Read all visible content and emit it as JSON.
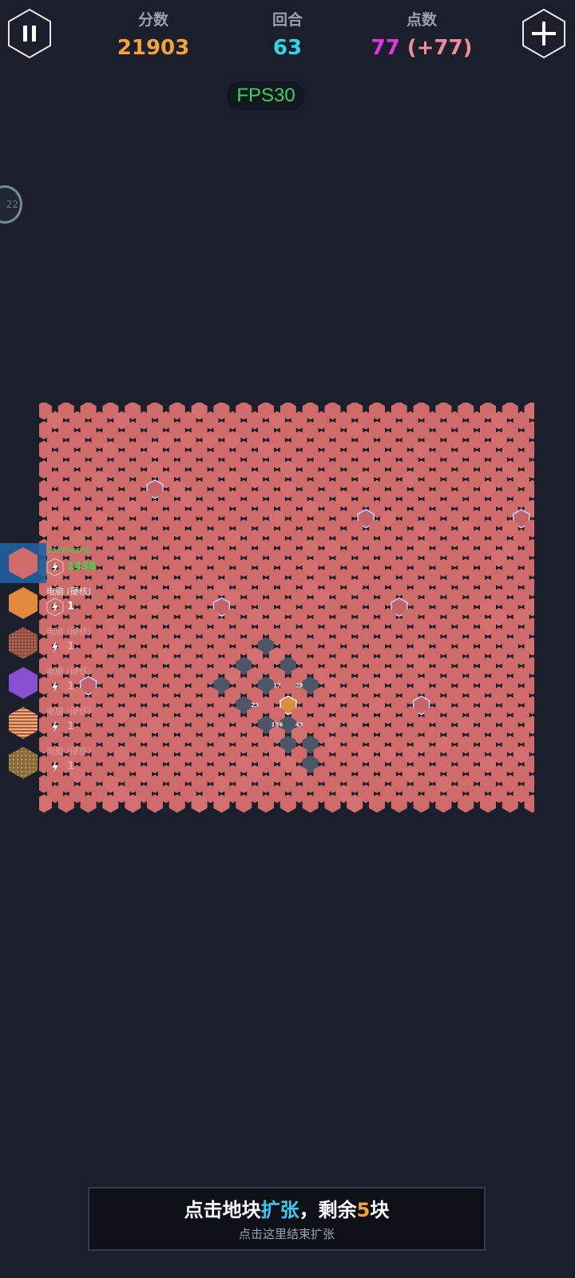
{
  "header": {
    "score_label": "分数",
    "score_value": "21903",
    "round_label": "回合",
    "round_value": "63",
    "points_label": "点数",
    "points_value": "77",
    "points_bonus": "(+77)"
  },
  "fps": "FPS30",
  "side_knob": "22",
  "players": [
    {
      "name": "username",
      "energy": "1438",
      "color": "#cf6b6b"
    },
    {
      "name": "电脑 (硬核)",
      "energy": "1",
      "color": "#e08a3c"
    },
    {
      "name": "电脑 (硬核)",
      "energy": "1",
      "color": "#b05a4c"
    },
    {
      "name": "电脑 (硬核)",
      "energy": "1",
      "color": "#8a4fd0"
    },
    {
      "name": "电脑 (硬核)",
      "energy": "1",
      "color": "#c06a40"
    },
    {
      "name": "电脑 (硬核)",
      "energy": "1",
      "color": "#9a7a48"
    }
  ],
  "board": {
    "cell_fill": "#cf6b6b",
    "highlight_cells": [
      "17",
      "28",
      "23",
      "106",
      "43"
    ]
  },
  "expand_panel": {
    "title_pre": "点击地块",
    "title_action": "扩张",
    "title_mid": "，剩余",
    "title_count": "5",
    "title_post": "块",
    "subtitle": "点击这里结束扩张"
  },
  "colors": {
    "background": "#1a1f2b",
    "score": "#f5a237",
    "round": "#2fd6e8",
    "points": "#e234e5",
    "fps": "#3ed15a"
  }
}
